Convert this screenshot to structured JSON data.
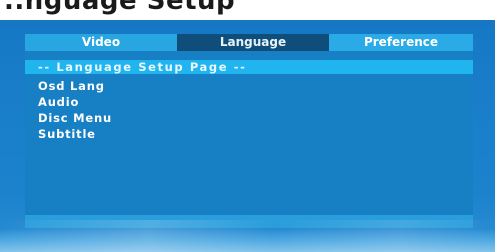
{
  "page": {
    "heading": "..nguage Setup"
  },
  "tabs": [
    {
      "label": "Video",
      "selected": false
    },
    {
      "label": "Language",
      "selected": true
    },
    {
      "label": "Preference",
      "selected": false
    }
  ],
  "panel": {
    "header": "-- Language Setup Page --",
    "items": [
      {
        "label": "Osd Lang"
      },
      {
        "label": "Audio"
      },
      {
        "label": "Disc Menu"
      },
      {
        "label": "Subtitle"
      }
    ]
  },
  "colors": {
    "screen_blue": "#1a7fcb",
    "tab_bar": "#2aa8e3",
    "tab_selected": "#0f4e7a",
    "header_highlight": "#20b5ee",
    "text": "#ffffff"
  }
}
